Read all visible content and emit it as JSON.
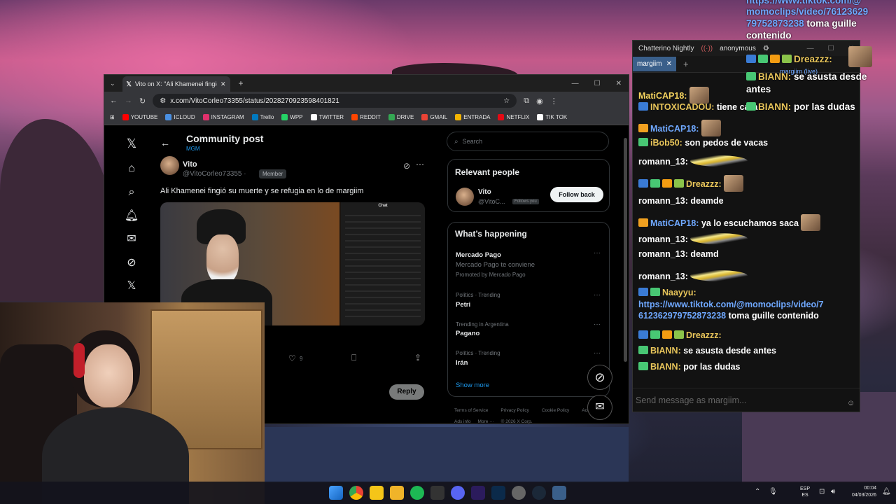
{
  "browser": {
    "tab_title": "Vito on X: \"Ali Khamenei fingió",
    "url": "x.com/VitoCorleo73355/status/2028270923598401821",
    "bookmarks": [
      "YOUTUBE",
      "ICLOUD",
      "INSTAGRAM",
      "Trello",
      "WPP",
      "TWITTER",
      "REDDIT",
      "DRIVE",
      "GMAIL",
      "ENTRADA",
      "NETFLIX",
      "TIK TOK"
    ],
    "bookmark_colors": [
      "#ff0000",
      "#4a90e2",
      "#e1306c",
      "#0079bf",
      "#25d366",
      "#ffffff",
      "#ff4500",
      "#34a853",
      "#ea4335",
      "#f4b400",
      "#e50914",
      "#ffffff"
    ]
  },
  "x": {
    "header_title": "Community post",
    "header_sub": "MGM",
    "author_name": "Vito",
    "author_handle": "@VitoCorleo73355 ·",
    "author_role": "Member",
    "post_text": "Ali Khamenei fingió  su muerte y se refugia en lo de margiim",
    "like_count": "9",
    "reply_button": "Reply",
    "search_placeholder": "Search",
    "relevant_title": "Relevant people",
    "rel_name": "Vito",
    "rel_handle": "@VitoC...",
    "rel_follows": "Follows you",
    "follow_back": "Follow back",
    "happening_title": "What’s happening",
    "trends": [
      {
        "context": "",
        "name": "Mercado Pago",
        "sub": "Mercado Pago te conviene",
        "promo": "Promoted by Mercado Pago"
      },
      {
        "context": "Politics · Trending",
        "name": "Petri"
      },
      {
        "context": "Trending in Argentina",
        "name": "Pagano"
      },
      {
        "context": "Politics · Trending",
        "name": "Irán"
      }
    ],
    "show_more": "Show more",
    "footer": [
      "Terms of Service",
      "Privacy Policy",
      "Cookie Policy",
      "Accessibility",
      "Ads info",
      "More ···",
      "© 2026 X Corp."
    ],
    "embedded_chat_title": "Chat"
  },
  "chatterino": {
    "title": "Chatterino Nightly",
    "user": "anonymous",
    "tab": "margiim",
    "channel_label": "margiim (live)",
    "input_placeholder": "Send message as margiim...",
    "messages": [
      {
        "user": "MatiCAP18:",
        "text": "",
        "color": "#f4d35e"
      },
      {
        "user": "INTOXICADOU:",
        "text": "tiene cara",
        "color": "#e8c55a"
      },
      {
        "user": "MatiCAP18:",
        "text": "",
        "color": "#6fa8ff"
      },
      {
        "user": "iBob50:",
        "text": "son pedos de vacas",
        "color": "#e8c55a"
      },
      {
        "user": "romann_13:",
        "text": "",
        "color": "#ffffff"
      },
      {
        "user": "Dreazzz:",
        "text": "",
        "color": "#e8c55a"
      },
      {
        "user": "romann_13:",
        "text": "deamde",
        "color": "#ffffff"
      },
      {
        "user": "MatiCAP18:",
        "text": "ya lo escuchamos saca",
        "color": "#6fa8ff"
      },
      {
        "user": "romann_13:",
        "text": "",
        "color": "#ffffff"
      },
      {
        "user": "romann_13:",
        "text": "deamd",
        "color": "#ffffff"
      },
      {
        "user": "romann_13:",
        "text": "",
        "color": "#ffffff"
      },
      {
        "user": "Naayyu:",
        "text": "",
        "color": "#e8c55a"
      },
      {
        "user": "",
        "text": "https://www.tiktok.com/@momoclips/video/7",
        "color": "#6fa8ff"
      },
      {
        "user": "",
        "text": "612362979752873238",
        "text2": "toma guille contenido",
        "color": "#6fa8ff"
      },
      {
        "user": "Dreazzz:",
        "text": "",
        "color": "#e8c55a"
      },
      {
        "user": "BIANN:",
        "text": "se asusta desde antes",
        "color": "#e8c55a"
      },
      {
        "user": "BIANN:",
        "text": "por las dudas",
        "color": "#e8c55a"
      }
    ]
  },
  "overlay": {
    "link1": "https://www.tiktok.com/@",
    "link2": "momoclips/video/76123629",
    "link3": "79752873238",
    "link3_text": "toma guille",
    "line4": "contenido",
    "dreazzz": "Dreazzz:",
    "biann1_user": "BIANN:",
    "biann1_text": "se asusta desde",
    "biann1_text2": "antes",
    "biann2_user": "BIANN:",
    "biann2_text": "por las dudas"
  },
  "taskbar": {
    "lang1": "ESP",
    "lang2": "ES",
    "time": "00:04",
    "date": "04/03/2026"
  }
}
